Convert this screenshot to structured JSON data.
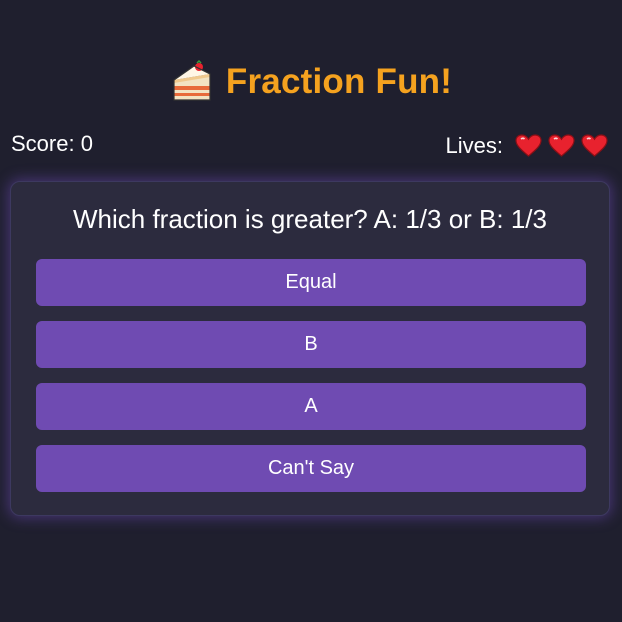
{
  "header": {
    "icon": "cake-slice-icon",
    "title": "Fraction Fun!"
  },
  "status": {
    "score_text": "Score: 0",
    "lives_label": "Lives:",
    "lives_count": 3,
    "heart_icon": "heart-icon"
  },
  "question": {
    "text": "Which fraction is greater? A: 1/3 or B: 1/3"
  },
  "answers": [
    {
      "label": "Equal"
    },
    {
      "label": "B"
    },
    {
      "label": "A"
    },
    {
      "label": "Can't Say"
    }
  ],
  "colors": {
    "background": "#1f1f2e",
    "card": "#2c2b3e",
    "title": "#f5a21f",
    "button": "#6f4bb2",
    "heart": "#e8222e"
  }
}
